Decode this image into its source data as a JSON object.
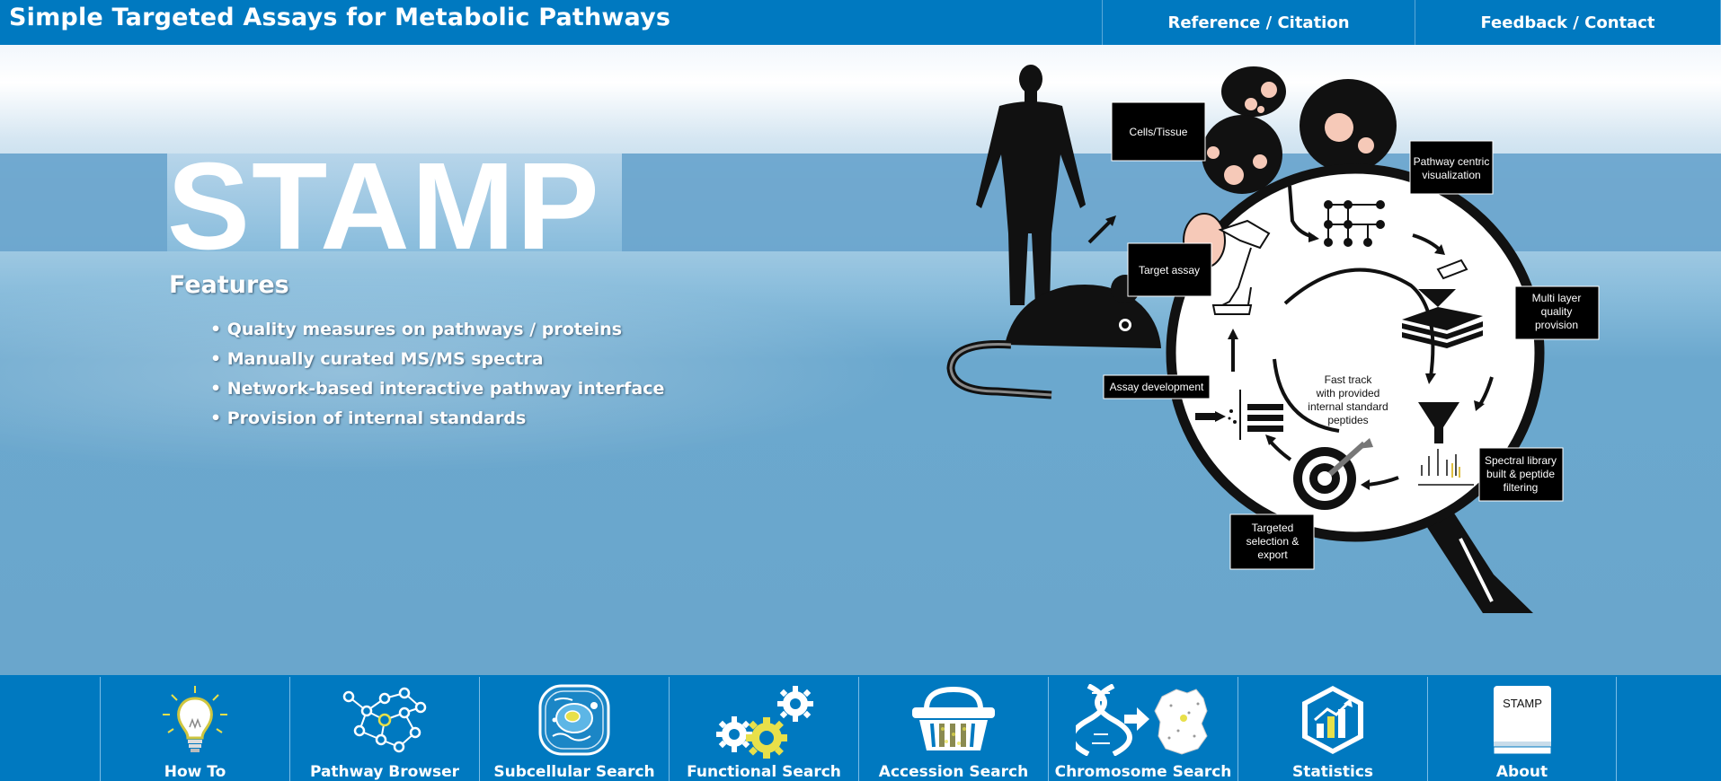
{
  "header": {
    "title": "Simple Targeted Assays for Metabolic Pathways",
    "links": {
      "reference": "Reference / Citation",
      "feedback": "Feedback / Contact"
    }
  },
  "hero": {
    "logo": "STAMP",
    "features_title": "Features",
    "features": [
      "• Quality measures on pathways / proteins",
      "• Manually curated MS/MS spectra",
      "• Network-based interactive pathway interface",
      "• Provision of internal standards"
    ]
  },
  "workflow": {
    "cells_tissue": "Cells/Tissue",
    "pathway_line1": "Pathway centric",
    "pathway_line2": "visualization",
    "target_assay": "Target assay",
    "multi_line1": "Multi layer",
    "multi_line2": "quality",
    "multi_line3": "provision",
    "assay_development": "Assay development",
    "center_line1": "Fast track",
    "center_line2": "with provided",
    "center_line3": "internal standard",
    "center_line4": "peptides",
    "spectral_line1": "Spectral library",
    "spectral_line2": "built & peptide",
    "spectral_line3": "filtering",
    "targeted_line1": "Targeted",
    "targeted_line2": "selection &",
    "targeted_line3": "export"
  },
  "nav": [
    {
      "label": "How To",
      "icon": "lightbulb-icon"
    },
    {
      "label": "Pathway Browser",
      "icon": "network-icon"
    },
    {
      "label": "Subcellular Search",
      "icon": "cell-icon"
    },
    {
      "label": "Functional Search",
      "icon": "gears-icon"
    },
    {
      "label": "Accession Search",
      "icon": "basket-icon"
    },
    {
      "label": "Chromosome Search",
      "icon": "dna-icon"
    },
    {
      "label": "Statistics",
      "icon": "chart-icon"
    },
    {
      "label": "About",
      "icon": "book-icon"
    }
  ],
  "about_icon_text": "STAMP",
  "colors": {
    "brand_blue": "#0079c0",
    "hero_blue": "#6aa6cc",
    "accent_yellow": "#e8e04a"
  }
}
